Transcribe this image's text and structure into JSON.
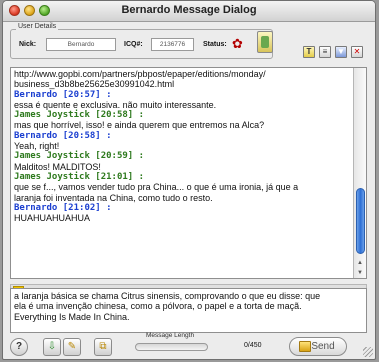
{
  "window": {
    "title": "Bernardo Message Dialog"
  },
  "user_details": {
    "legend": "User Details",
    "nick_label": "Nick:",
    "nick_value": "Bernardo",
    "icq_label": "ICQ#:",
    "icq_value": "2136776",
    "status_label": "Status:"
  },
  "toolbar": {
    "t_label": "T",
    "close_label": "✕"
  },
  "messages": [
    {
      "type": "text",
      "text": "http://www.gopbi.com/partners/pbpost/epaper/editions/monday/"
    },
    {
      "type": "text",
      "text": "business_d3b8be25625e30991042.html"
    },
    {
      "type": "sender",
      "who": "bernardo",
      "text": "Bernardo [20:57] :"
    },
    {
      "type": "text",
      "text": "essa é quente e exclusiva. não muito interessante."
    },
    {
      "type": "sender",
      "who": "james",
      "text": "James Joystick [20:58] :"
    },
    {
      "type": "text",
      "text": "mas que horrível, isso! e ainda querem que entremos na Alca?"
    },
    {
      "type": "sender",
      "who": "bernardo",
      "text": "Bernardo [20:58] :"
    },
    {
      "type": "text",
      "text": "Yeah, right!"
    },
    {
      "type": "sender",
      "who": "james",
      "text": "James Joystick [20:59] :"
    },
    {
      "type": "text",
      "text": "Malditos! MALDITOS!"
    },
    {
      "type": "sender",
      "who": "james",
      "text": "James Joystick [21:01] :"
    },
    {
      "type": "text",
      "text": "que se f..., vamos vender tudo pra China... o que é uma ironia, já que a"
    },
    {
      "type": "text",
      "text": "laranja foi inventada na China, como tudo o resto."
    },
    {
      "type": "sender",
      "who": "bernardo",
      "text": "Bernardo [21:02] :"
    },
    {
      "type": "text",
      "text": "HUAHUAHUAHUA"
    }
  ],
  "compose": {
    "lines": [
      "a laranja básica se chama Citrus sinensis, comprovando o que eu disse: que",
      "ela é uma invenção chinesa, como a pólvora, o papel e a torta de maçã.",
      "Everything Is Made In China."
    ]
  },
  "bottom": {
    "help_label": "?",
    "message_length_label": "Message Length",
    "message_length_fraction": 0.0,
    "length_count": "0/450",
    "send_label": "Send"
  },
  "colors": {
    "bernardo": "#1b3fd0",
    "james": "#2e7a1e",
    "scroll_thumb": "#2c6ed5",
    "splitter_handle": "#f2c500"
  }
}
